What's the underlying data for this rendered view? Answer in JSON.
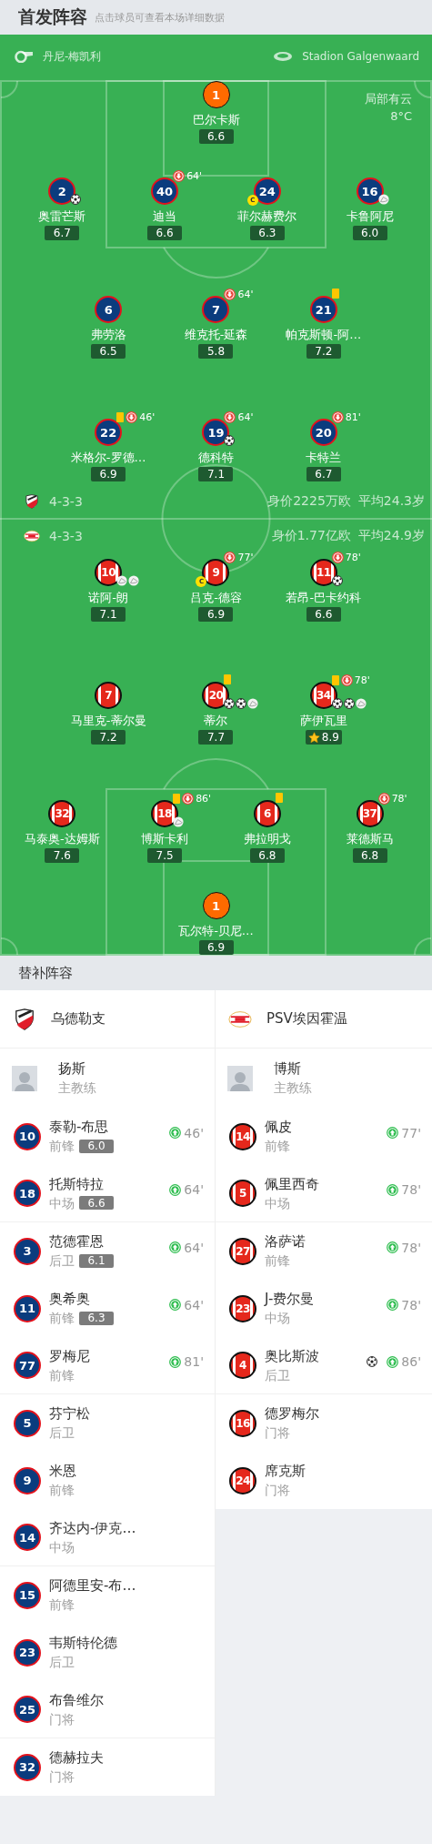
{
  "header": {
    "title": "首发阵容",
    "subtitle": "点击球员可查看本场详细数据"
  },
  "match_info": {
    "referee": "丹尼-梅凯利",
    "stadium": "Stadion Galgenwaard",
    "weather": "局部有云",
    "temperature": "8°C"
  },
  "home": {
    "kind": "solid",
    "formation": "4-3-3",
    "value": "身价2225万欧",
    "average_age": "平均24.3岁",
    "rows": [
      {
        "kind": "goalkeeper",
        "players": [
          {
            "number": "1",
            "name": "巴尔卡斯",
            "rating": "6.6"
          }
        ]
      },
      {
        "kind": "outfield",
        "players": [
          {
            "number": "2",
            "name": "奥雷芒斯",
            "rating": "6.7",
            "events": [
              {
                "kind": "goal"
              }
            ]
          },
          {
            "number": "40",
            "name": "迪当",
            "rating": "6.6",
            "events": [
              {
                "kind": "sub_off",
                "minute": "64'"
              }
            ]
          },
          {
            "number": "24",
            "name": "菲尔赫费尔",
            "rating": "6.3",
            "events": [
              {
                "kind": "captain",
                "label": "C"
              }
            ]
          },
          {
            "number": "16",
            "name": "卡鲁阿尼",
            "rating": "6.0",
            "events": [
              {
                "kind": "assist"
              }
            ]
          }
        ]
      },
      {
        "kind": "outfield",
        "players": [
          {
            "number": "6",
            "name": "弗劳洛",
            "rating": "6.5"
          },
          {
            "number": "7",
            "name": "维克托-延森",
            "rating": "5.8",
            "events": [
              {
                "kind": "sub_off",
                "minute": "64'"
              }
            ]
          },
          {
            "number": "21",
            "name": "帕克斯顿-阿…",
            "rating": "7.2",
            "events": [
              {
                "kind": "yellow_card"
              }
            ]
          }
        ]
      },
      {
        "kind": "outfield",
        "players": [
          {
            "number": "22",
            "name": "米格尔-罗德…",
            "rating": "6.9",
            "events": [
              {
                "kind": "yellow_card"
              },
              {
                "kind": "sub_off",
                "minute": "46'"
              }
            ]
          },
          {
            "number": "19",
            "name": "德科特",
            "rating": "7.1",
            "events": [
              {
                "kind": "sub_off",
                "minute": "64'"
              },
              {
                "kind": "goal"
              }
            ]
          },
          {
            "number": "20",
            "name": "卡特兰",
            "rating": "6.7",
            "events": [
              {
                "kind": "sub_off",
                "minute": "81'"
              }
            ]
          }
        ]
      }
    ]
  },
  "away": {
    "kind": "stripes",
    "formation": "4-3-3",
    "value": "身价1.77亿欧",
    "average_age": "平均24.9岁",
    "rows": [
      {
        "kind": "outfield",
        "players": [
          {
            "number": "10",
            "name": "诺阿-朗",
            "rating": "7.1",
            "events": [
              {
                "kind": "assist"
              },
              {
                "kind": "assist"
              }
            ]
          },
          {
            "number": "9",
            "name": "吕克-德容",
            "rating": "6.9",
            "events": [
              {
                "kind": "sub_off",
                "minute": "77'"
              },
              {
                "kind": "captain",
                "label": "C"
              }
            ]
          },
          {
            "number": "11",
            "name": "若昂-巴卡约科",
            "rating": "6.6",
            "events": [
              {
                "kind": "sub_off",
                "minute": "78'"
              },
              {
                "kind": "goal"
              }
            ]
          }
        ]
      },
      {
        "kind": "outfield",
        "players": [
          {
            "number": "7",
            "name": "马里克-蒂尔曼",
            "rating": "7.2"
          },
          {
            "number": "20",
            "name": "蒂尔",
            "rating": "7.7",
            "events": [
              {
                "kind": "yellow_card"
              },
              {
                "kind": "goal"
              },
              {
                "kind": "goal"
              },
              {
                "kind": "assist"
              }
            ]
          },
          {
            "number": "34",
            "name": "萨伊瓦里",
            "rating": "8.9",
            "events": [
              {
                "kind": "star"
              },
              {
                "kind": "yellow_card"
              },
              {
                "kind": "sub_off",
                "minute": "78'"
              },
              {
                "kind": "goal"
              },
              {
                "kind": "goal"
              },
              {
                "kind": "assist"
              }
            ]
          }
        ]
      },
      {
        "kind": "outfield",
        "players": [
          {
            "number": "32",
            "name": "马泰奥-达姆斯",
            "rating": "7.6"
          },
          {
            "number": "18",
            "name": "博斯卡利",
            "rating": "7.5",
            "events": [
              {
                "kind": "yellow_card"
              },
              {
                "kind": "sub_off",
                "minute": "86'"
              },
              {
                "kind": "assist"
              }
            ]
          },
          {
            "number": "6",
            "name": "弗拉明戈",
            "rating": "6.8",
            "events": [
              {
                "kind": "yellow_card"
              }
            ]
          },
          {
            "number": "37",
            "name": "莱德斯马",
            "rating": "6.8",
            "events": [
              {
                "kind": "sub_off",
                "minute": "78'"
              }
            ]
          }
        ]
      },
      {
        "kind": "goalkeeper",
        "players": [
          {
            "number": "1",
            "name": "瓦尔特-贝尼…",
            "rating": "6.9"
          }
        ]
      }
    ]
  },
  "substitutes": {
    "title": "替补阵容",
    "teams": [
      {
        "name": "乌德勒支",
        "kind": "solid",
        "coach": {
          "name": "扬斯",
          "role": "主教练"
        },
        "players": [
          {
            "number": "10",
            "name": "泰勒-布思",
            "position": "前锋",
            "rating": "6.0",
            "events": [
              {
                "kind": "sub_on",
                "minute": "46'"
              }
            ]
          },
          {
            "number": "18",
            "name": "托斯特拉",
            "position": "中场",
            "rating": "6.6",
            "events": [
              {
                "kind": "sub_on",
                "minute": "64'"
              }
            ]
          },
          {
            "number": "3",
            "name": "范德霍恩",
            "position": "后卫",
            "rating": "6.1",
            "events": [
              {
                "kind": "sub_on",
                "minute": "64'"
              }
            ]
          },
          {
            "number": "11",
            "name": "奥希奥",
            "position": "前锋",
            "rating": "6.3",
            "events": [
              {
                "kind": "sub_on",
                "minute": "64'"
              }
            ]
          },
          {
            "number": "77",
            "name": "罗梅尼",
            "position": "前锋",
            "events": [
              {
                "kind": "sub_on",
                "minute": "81'"
              }
            ]
          },
          {
            "number": "5",
            "name": "芬宁松",
            "position": "后卫"
          },
          {
            "number": "9",
            "name": "米恩",
            "position": "前锋"
          },
          {
            "number": "14",
            "name": "齐达内-伊克…",
            "position": "中场"
          },
          {
            "number": "15",
            "name": "阿德里安-布…",
            "position": "前锋"
          },
          {
            "number": "23",
            "name": "韦斯特伦德",
            "position": "后卫"
          },
          {
            "number": "25",
            "name": "布鲁维尔",
            "position": "门将"
          },
          {
            "number": "32",
            "name": "德赫拉夫",
            "position": "门将"
          }
        ]
      },
      {
        "name": "PSV埃因霍温",
        "kind": "stripes",
        "coach": {
          "name": "博斯",
          "role": "主教练"
        },
        "players": [
          {
            "number": "14",
            "name": "佩皮",
            "position": "前锋",
            "events": [
              {
                "kind": "sub_on",
                "minute": "77'"
              }
            ]
          },
          {
            "number": "5",
            "name": "佩里西奇",
            "position": "中场",
            "events": [
              {
                "kind": "sub_on",
                "minute": "78'"
              }
            ]
          },
          {
            "number": "27",
            "name": "洛萨诺",
            "position": "前锋",
            "events": [
              {
                "kind": "sub_on",
                "minute": "78'"
              }
            ]
          },
          {
            "number": "23",
            "name": "J-费尔曼",
            "position": "中场",
            "events": [
              {
                "kind": "sub_on",
                "minute": "78'"
              }
            ]
          },
          {
            "number": "4",
            "name": "奥比斯波",
            "position": "后卫",
            "events": [
              {
                "kind": "goal"
              },
              {
                "kind": "sub_on",
                "minute": "86'"
              }
            ]
          },
          {
            "number": "16",
            "name": "德罗梅尔",
            "position": "门将"
          },
          {
            "number": "24",
            "name": "席克斯",
            "position": "门将"
          }
        ]
      }
    ]
  }
}
